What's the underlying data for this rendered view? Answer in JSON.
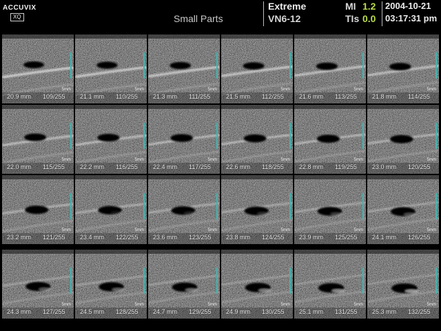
{
  "header": {
    "logo": "ACCUVIX",
    "logo_sub": "XQ",
    "mode": "Small Parts",
    "preset": "Extreme",
    "probe": "VN6-12",
    "mi_label": "MI",
    "mi_value": "1.2",
    "tis_label": "TIs",
    "tis_value": "0.0",
    "date": "2004-10-21",
    "time": "03:17:31 pm"
  },
  "frames": [
    {
      "depth": "20.9 mm",
      "frame": "109/255",
      "scale": "5mm"
    },
    {
      "depth": "21.1 mm",
      "frame": "110/255",
      "scale": "5mm"
    },
    {
      "depth": "21.3 mm",
      "frame": "111/255",
      "scale": "5mm"
    },
    {
      "depth": "21.5 mm",
      "frame": "112/255",
      "scale": "5mm"
    },
    {
      "depth": "21.6 mm",
      "frame": "113/255",
      "scale": "5mm"
    },
    {
      "depth": "21.8 mm",
      "frame": "114/255",
      "scale": "5mm"
    },
    {
      "depth": "22.0 mm",
      "frame": "115/255",
      "scale": "5mm"
    },
    {
      "depth": "22.2 mm",
      "frame": "116/255",
      "scale": "5mm"
    },
    {
      "depth": "22.4 mm",
      "frame": "117/255",
      "scale": "5mm"
    },
    {
      "depth": "22.6 mm",
      "frame": "118/255",
      "scale": "5mm"
    },
    {
      "depth": "22.8 mm",
      "frame": "119/255",
      "scale": "5mm"
    },
    {
      "depth": "23.0 mm",
      "frame": "120/255",
      "scale": "5mm"
    },
    {
      "depth": "23.2 mm",
      "frame": "121/255",
      "scale": "5mm"
    },
    {
      "depth": "23.4 mm",
      "frame": "122/255",
      "scale": "5mm"
    },
    {
      "depth": "23.6 mm",
      "frame": "123/255",
      "scale": "5mm"
    },
    {
      "depth": "23.8 mm",
      "frame": "124/255",
      "scale": "5mm"
    },
    {
      "depth": "23.9 mm",
      "frame": "125/255",
      "scale": "5mm"
    },
    {
      "depth": "24.1 mm",
      "frame": "126/255",
      "scale": "5mm"
    },
    {
      "depth": "24.3 mm",
      "frame": "127/255",
      "scale": "5mm"
    },
    {
      "depth": "24.5 mm",
      "frame": "128/255",
      "scale": "5mm"
    },
    {
      "depth": "24.7 mm",
      "frame": "129/255",
      "scale": "5mm"
    },
    {
      "depth": "24.9 mm",
      "frame": "130/255",
      "scale": "5mm"
    },
    {
      "depth": "25.1 mm",
      "frame": "131/255",
      "scale": "5mm"
    },
    {
      "depth": "25.3 mm",
      "frame": "132/255",
      "scale": "5mm",
      "selected": true
    }
  ],
  "colors": {
    "accent_green": "#b9dc4c",
    "scale_bar": "#3fb6b2",
    "selection": "#d8d46a"
  }
}
